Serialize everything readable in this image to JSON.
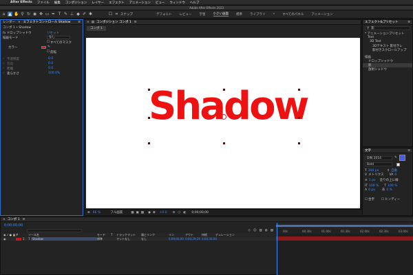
{
  "menubar": {
    "apple": "",
    "items": [
      "After Effects",
      "ファイル",
      "編集",
      "コンポジション",
      "レイヤー",
      "エフェクト",
      "アニメーション",
      "ビュー",
      "ウィンドウ",
      "ヘルプ"
    ]
  },
  "window_title": "Adobe After Effects 2023",
  "toolbar": {
    "snap_label": "スナップ",
    "workspaces": [
      "デフォルト",
      "レビュー",
      "学習",
      "小さい画面",
      "標準",
      "ライブラリ",
      "»",
      "すべてのパネル",
      "アニメーション"
    ],
    "active_workspace": "小さい画面"
  },
  "effects_panel": {
    "tab1": "レンダー",
    "tab2": "エフェクトコントロール Shadow",
    "layer_path": "コンポ 1 • Shadow",
    "rows": [
      {
        "label": "fx ドロップシャドウ",
        "value": "リセット"
      },
      {
        "label": "描画モード",
        "value": "なし"
      },
      {
        "label": "",
        "value": "すべてのマスク"
      },
      {
        "label": "カラー",
        "value": ""
      },
      {
        "label": "",
        "value": "反転"
      },
      {
        "label": "不透明度",
        "value": "0.0"
      },
      {
        "label": "方向",
        "value": "0.0"
      },
      {
        "label": "距離",
        "value": "0.0"
      },
      {
        "label": "柔らかさ",
        "value": "100.0%"
      }
    ]
  },
  "comp_panel": {
    "tab": "コンポジション コンポ 1",
    "sub_tab": "コンポ 1",
    "canvas_text": "Shadow",
    "footer": {
      "zoom": "66 %",
      "resolution": "フル画質",
      "time": "0;00;00;00",
      "exposure": "+0.0"
    }
  },
  "presets_panel": {
    "title": "エフェクト&プリセット",
    "search_value": "影",
    "items": [
      "* アニメーションプリセット",
      "Text",
      "3D Text",
      "3Dテキスト 影付きレ",
      "影付きスクロールアップ",
      "描画",
      "ドロップシャドウ",
      "影",
      "放射シャドウ"
    ]
  },
  "character_panel": {
    "title": "文字",
    "font": "DIN 2014",
    "style": "Bold",
    "size": "300 px",
    "leading": "自動",
    "kerning": "メトリクス",
    "tracking": "0",
    "stroke": "1 px",
    "stroke_mode": "塗りの上に線",
    "vscale": "100 %",
    "hscale": "100 %",
    "baseline": "0 px",
    "tsume": "0 %",
    "ligature": "合字",
    "hindi": "ヒンディー"
  },
  "timeline": {
    "tab": "コンポ 1",
    "timecode": "0;00;00;00",
    "search_placeholder": "",
    "headers": [
      "ソース名",
      "モード",
      "T",
      "トラックマット",
      "親とリンク",
      "イン",
      "アウト",
      "持続",
      "デュレーション"
    ],
    "layer": {
      "index": "1",
      "name": "Shadow",
      "mode": "標準",
      "matte": "マットなし",
      "parent": "なし",
      "in": "0;00;00;00",
      "out": "0;00;29;29",
      "duration": "0;00;30;00"
    },
    "ruler": [
      "00s",
      "00:30s",
      "01:00s",
      "01:30s",
      "02:00s",
      "02:30s",
      "03:00s"
    ]
  },
  "colors": {
    "accent": "#2d6fd6",
    "text_red": "#ee1111",
    "track": "#8b1a1a",
    "swatch_fill": "#4a5ae8"
  }
}
